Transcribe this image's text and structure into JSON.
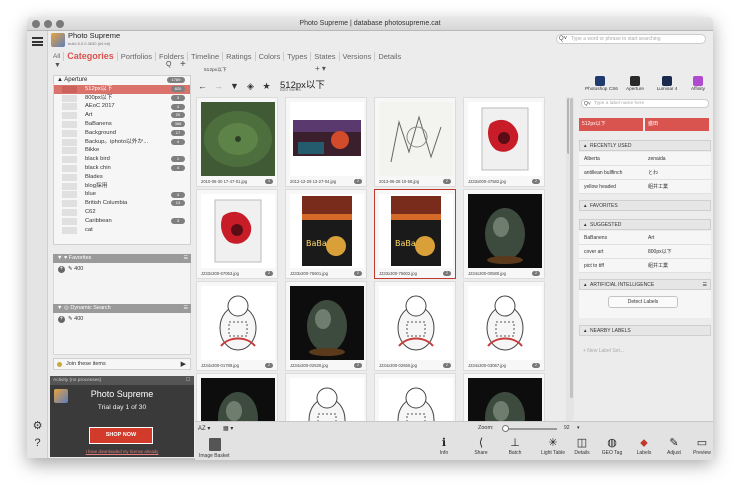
{
  "window": {
    "title": "Photo Supreme | database photosupreme.cat"
  },
  "app": {
    "name": "Photo Supreme",
    "build": "build 6.0.0.3630 (64 bit)"
  },
  "tabs": [
    "All",
    "Categories",
    "Portfolios",
    "Folders",
    "Timeline",
    "Ratings",
    "Colors",
    "Types",
    "States",
    "Versions",
    "Details"
  ],
  "search": {
    "placeholder": "Type a word or phrase to start searching"
  },
  "tree": {
    "root": {
      "label": "Aperture",
      "count": "1789"
    },
    "items": [
      {
        "label": "512px以下",
        "count": "820",
        "selected": true
      },
      {
        "label": "800px以下",
        "count": "3"
      },
      {
        "label": "AEoC 2017",
        "count": "4"
      },
      {
        "label": "Art",
        "count": "20"
      },
      {
        "label": "BaBanens",
        "count": "368"
      },
      {
        "label": "Background",
        "count": "17"
      },
      {
        "label": "Backup。iphoto以外か...",
        "count": "4"
      },
      {
        "label": "Bikke",
        "count": ""
      },
      {
        "label": "black bird",
        "count": "1"
      },
      {
        "label": "black chin",
        "count": "4"
      },
      {
        "label": "Blades",
        "count": ""
      },
      {
        "label": "blog採用",
        "count": ""
      },
      {
        "label": "blue",
        "count": "4"
      },
      {
        "label": "British Columbia",
        "count": "13"
      },
      {
        "label": "C62",
        "count": ""
      },
      {
        "label": "Caribbean",
        "count": "3"
      },
      {
        "label": "cat",
        "count": ""
      }
    ]
  },
  "favorites": {
    "title": "Favorites",
    "add_value": "400"
  },
  "dynamic_search": {
    "title": "Dynamic Search",
    "add_value": "400"
  },
  "join": {
    "label": "Join these items"
  },
  "promo": {
    "header": "Activity (no processes)",
    "title": "Photo Supreme",
    "trial": "Trial day 1 of 30",
    "shop": "SHOP NOW",
    "link": "I have downloaded my license already"
  },
  "center": {
    "tab": "512px以下",
    "add_tab": "+ ▾",
    "title": "512px以下",
    "subtitle": "820 items"
  },
  "thumbnails": [
    {
      "file": "2010-05-30 17-47-01.jpg",
      "badge": "4",
      "art": "lotus"
    },
    {
      "file": "2012-12-29 13-27-04.jpg",
      "badge": "2",
      "art": "painting"
    },
    {
      "file": "2013-06-28 10-58.jpg",
      "badge": "2",
      "art": "sketch"
    },
    {
      "file": "J233x000-47582.jpg",
      "badge": "2",
      "art": "card"
    },
    {
      "file": "J233x300-67053.jpg",
      "badge": "2",
      "art": "card"
    },
    {
      "file": "J233x300-75601.jpg",
      "badge": "2",
      "art": "poster"
    },
    {
      "file": "J233x300-75602.jpg",
      "badge": "2",
      "art": "poster",
      "selected": true
    },
    {
      "file": "J234x300-00580.jpg",
      "badge": "2",
      "art": "egg"
    },
    {
      "file": "J234x300-01789.jpg",
      "badge": "2",
      "art": "cat"
    },
    {
      "file": "J234x300-02530.jpg",
      "badge": "2",
      "art": "egg"
    },
    {
      "file": "J234x300-02650.jpg",
      "badge": "2",
      "art": "cat"
    },
    {
      "file": "J234x300-03067.jpg",
      "badge": "2",
      "art": "cat"
    },
    {
      "file": "",
      "badge": "",
      "art": "egg"
    },
    {
      "file": "",
      "badge": "",
      "art": "cat"
    },
    {
      "file": "",
      "badge": "",
      "art": "cat"
    },
    {
      "file": "",
      "badge": "",
      "art": "egg"
    }
  ],
  "bottom": {
    "sort": "AZ ▾",
    "view": "▦ ▾",
    "zoom_label": "Zoom:",
    "zoom_value": "92",
    "basket": "Image Basket",
    "tools": [
      "Info",
      "Share",
      "Batch",
      "Light Table",
      "Details",
      "GEO Tag",
      "Labels",
      "Adjust",
      "Preview"
    ]
  },
  "right": {
    "apps": [
      {
        "label": "Photoshop CS6",
        "color": "#1e3a6e"
      },
      {
        "label": "Aperture",
        "color": "#2a2a2a"
      },
      {
        "label": "Luminar 4",
        "color": "#1a2a4e"
      },
      {
        "label": "Affinity",
        "color": "#b04ad0"
      }
    ],
    "label_search": {
      "placeholder": "Type a label name here"
    },
    "chips": [
      "512px以下",
      "盛田"
    ],
    "recently_used": {
      "title": "RECENTLY USED",
      "rows": [
        {
          "k": "Alberta",
          "v": "zenaida"
        },
        {
          "k": "antillean bullfinch",
          "v": "とわ"
        },
        {
          "k": "yellow headed",
          "v": "組井工業"
        }
      ]
    },
    "favorites": {
      "title": "FAVORITES"
    },
    "suggested": {
      "title": "SUGGESTED",
      "rows": [
        {
          "k": "BaBanens",
          "v": "Art"
        },
        {
          "k": "cover art",
          "v": "800px以下"
        },
        {
          "k": "pict to tiff",
          "v": "組井工業"
        }
      ]
    },
    "ai": {
      "title": "ARTIFICIAL INTELLIGENCE",
      "button": "Detect Labels"
    },
    "nearby": {
      "title": "NEARBY LABELS"
    },
    "new_label": "+ New Label Set..."
  }
}
